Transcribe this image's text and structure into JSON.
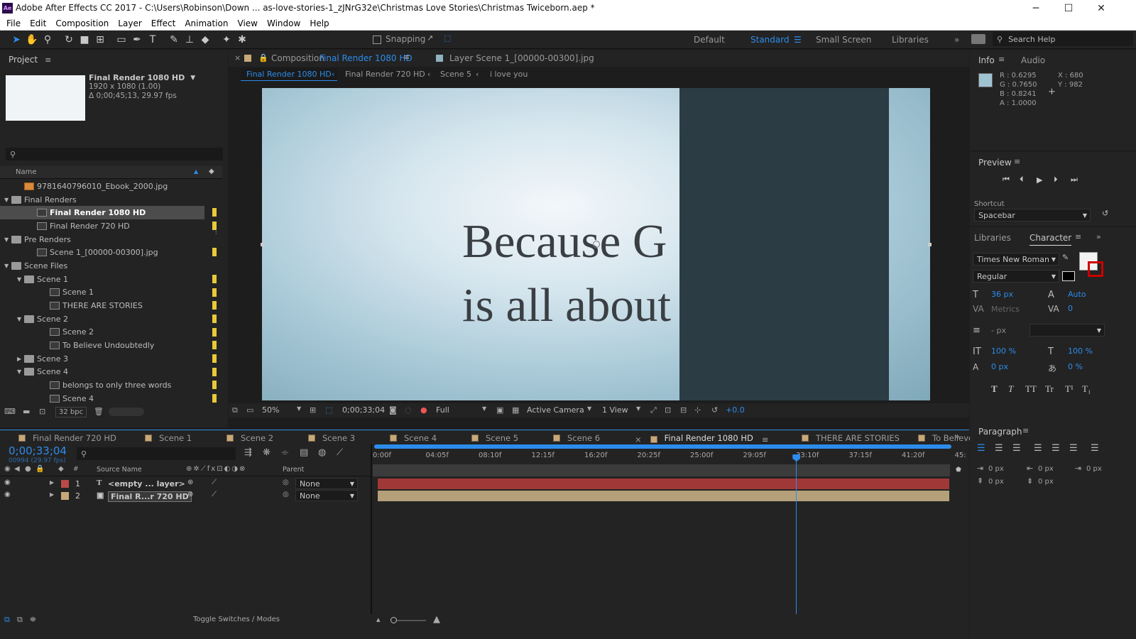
{
  "window": {
    "title": "Adobe After Effects CC 2017 - C:\\Users\\Robinson\\Down ... as-love-stories-1_zJNrG32e\\Christmas Love Stories\\Christmas Twiceborn.aep *",
    "app_icon": "Ae",
    "minimize": "─",
    "maximize": "☐",
    "close": "✕"
  },
  "menu": [
    "File",
    "Edit",
    "Composition",
    "Layer",
    "Effect",
    "Animation",
    "View",
    "Window",
    "Help"
  ],
  "toolbar": {
    "snapping_label": "Snapping",
    "workspaces": [
      "Default",
      "Standard",
      "Small Screen",
      "Libraries"
    ],
    "active_workspace": "Standard",
    "search_placeholder": "Search Help"
  },
  "project": {
    "title": "Project",
    "comp_name": "Final Render 1080 HD",
    "comp_size": "1920 x 1080 (1.00)",
    "comp_duration": "Δ 0;00;45;13, 29.97 fps",
    "col_name": "Name",
    "items": [
      {
        "name": "9781640796010_Ebook_2000.jpg",
        "indent": 1,
        "type": "image"
      },
      {
        "name": "Final Renders",
        "indent": 0,
        "type": "folder",
        "tri": "▼"
      },
      {
        "name": "Final Render 1080 HD",
        "indent": 2,
        "type": "comp",
        "selected": true
      },
      {
        "name": "Final Render 720 HD",
        "indent": 2,
        "type": "comp"
      },
      {
        "name": "Pre Renders",
        "indent": 0,
        "type": "folder",
        "tri": "▼"
      },
      {
        "name": "Scene 1_[00000-00300].jpg",
        "indent": 2,
        "type": "seq"
      },
      {
        "name": "Scene Files",
        "indent": 0,
        "type": "folder",
        "tri": "▼"
      },
      {
        "name": "Scene 1",
        "indent": 1,
        "type": "folder",
        "tri": "▼"
      },
      {
        "name": "Scene 1",
        "indent": 3,
        "type": "comp"
      },
      {
        "name": "THERE ARE STORIES",
        "indent": 3,
        "type": "comp"
      },
      {
        "name": "Scene 2",
        "indent": 1,
        "type": "folder",
        "tri": "▼"
      },
      {
        "name": "Scene 2",
        "indent": 3,
        "type": "comp"
      },
      {
        "name": "To Believe Undoubtedly",
        "indent": 3,
        "type": "comp"
      },
      {
        "name": "Scene 3",
        "indent": 1,
        "type": "folder",
        "tri": "▶"
      },
      {
        "name": "Scene 4",
        "indent": 1,
        "type": "folder",
        "tri": "▼"
      },
      {
        "name": "belongs to only three words",
        "indent": 3,
        "type": "comp"
      },
      {
        "name": "Scene 4",
        "indent": 3,
        "type": "comp"
      }
    ],
    "bpc": "32 bpc"
  },
  "viewer": {
    "comp_tab_prefix": "Composition",
    "comp_tab_name": "Final Render 1080 HD",
    "layer_tab": "Layer Scene 1_[00000-00300].jpg",
    "breadcrumbs": [
      "Final Render 1080 HD",
      "Final Render 720 HD",
      "Scene 5",
      "i love you"
    ],
    "text_line1": "Because G",
    "text_line2": "is all about",
    "zoom": "50%",
    "timecode": "0;00;33;04",
    "resolution": "Full",
    "camera": "Active Camera",
    "views": "1 View",
    "exposure": "+0.0"
  },
  "info": {
    "tab_info": "Info",
    "tab_audio": "Audio",
    "r": "R : 0.6295",
    "g": "G : 0.7650",
    "b": "B : 0.8241",
    "a": "A : 1.0000",
    "x": "X : 680",
    "y": "Y : 982",
    "swatch_color": "#a0c3d2"
  },
  "preview": {
    "title": "Preview",
    "shortcut_label": "Shortcut",
    "shortcut_value": "Spacebar"
  },
  "character": {
    "tab_libraries": "Libraries",
    "tab_character": "Character",
    "font": "Times New Roman",
    "style": "Regular",
    "size": "36 px",
    "leading": "Auto",
    "kerning": "Metrics",
    "tracking": "0",
    "stroke": "- px",
    "vscale": "100 %",
    "hscale": "100 %",
    "baseline": "0 px",
    "tsume": "0 %",
    "styles": [
      "T",
      "T",
      "TT",
      "Tr",
      "T¹",
      "T₁"
    ]
  },
  "paragraph": {
    "title": "Paragraph",
    "indent_left": "0 px",
    "indent_right": "0 px",
    "first_line": "0 px",
    "space_before": "0 px",
    "space_after": "0 px"
  },
  "timeline": {
    "tabs": [
      "Final Render 720 HD",
      "Scene 1",
      "Scene 2",
      "Scene 3",
      "Scene 4",
      "Scene 5",
      "Scene 6",
      "Final Render 1080 HD",
      "THERE ARE STORIES",
      "To Believe U"
    ],
    "active_tab": "Final Render 1080 HD",
    "timecode": "0;00;33;04",
    "frame_info": "00994 (29.97 fps)",
    "ruler": [
      "0:00f",
      "04:05f",
      "08:10f",
      "12:15f",
      "16:20f",
      "20:25f",
      "25:00f",
      "29:05f",
      "33:10f",
      "37:15f",
      "41:20f",
      "45:"
    ],
    "playhead_fraction": 0.731,
    "col_source": "Source Name",
    "col_parent": "Parent",
    "layers": [
      {
        "num": "1",
        "type": "T",
        "name": "<empty ... layer>",
        "parent": "None",
        "color": "#b94a48",
        "bar": "#a03838"
      },
      {
        "num": "2",
        "type": "comp",
        "name": "Final R...r 720 HD",
        "parent": "None",
        "color": "#c9a878",
        "bar": "#b5a07a"
      }
    ],
    "toggle_label": "Toggle Switches / Modes"
  }
}
